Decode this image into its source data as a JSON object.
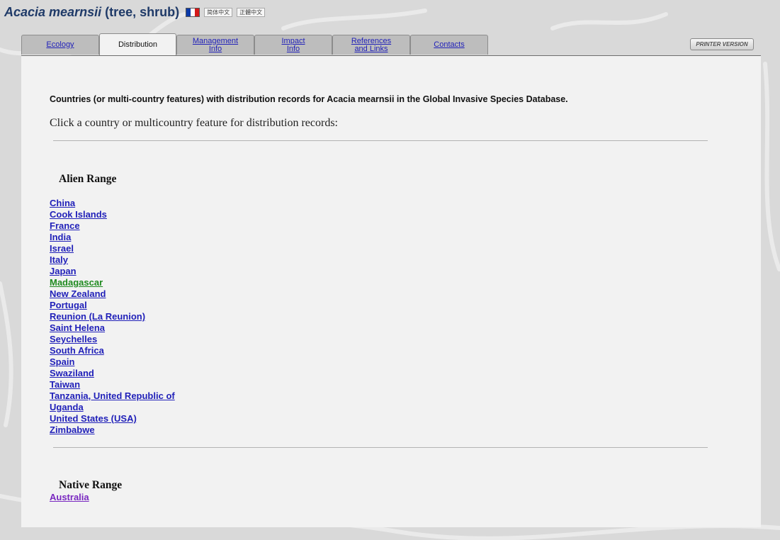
{
  "header": {
    "scientific_name": "Acacia mearnsii",
    "common_names": " (tree, shrub)",
    "lang_simplified": "简体中文",
    "lang_traditional": "正體中文",
    "flag_colors": [
      "#0b3aa8",
      "#ffffff",
      "#d41919"
    ]
  },
  "tabs": [
    {
      "label_line1": "Ecology",
      "label_line2": ""
    },
    {
      "label_line1": "Distribution",
      "label_line2": ""
    },
    {
      "label_line1": "Management",
      "label_line2": "Info"
    },
    {
      "label_line1": "Impact",
      "label_line2": "Info"
    },
    {
      "label_line1": "References",
      "label_line2": "and Links"
    },
    {
      "label_line1": "Contacts",
      "label_line2": ""
    }
  ],
  "printer_label": "PRINTER VERSION",
  "intro": "Countries (or multi-country features) with distribution records for Acacia mearnsii in the Global Invasive Species Database.",
  "click_prompt": "Click a country or multicountry feature for distribution records:",
  "alien_range": {
    "heading": "Alien Range",
    "countries": [
      {
        "name": "China",
        "color": "#2121b9"
      },
      {
        "name": "Cook Islands",
        "color": "#2121b9"
      },
      {
        "name": "France",
        "color": "#2121b9"
      },
      {
        "name": "India",
        "color": "#2121b9"
      },
      {
        "name": "Israel",
        "color": "#2121b9"
      },
      {
        "name": "Italy",
        "color": "#2121b9"
      },
      {
        "name": "Japan",
        "color": "#2121b9"
      },
      {
        "name": "Madagascar",
        "color": "#1f8a1f"
      },
      {
        "name": "New Zealand",
        "color": "#2121b9"
      },
      {
        "name": "Portugal",
        "color": "#2121b9"
      },
      {
        "name": "Reunion (La Reunion)",
        "color": "#2121b9"
      },
      {
        "name": "Saint Helena",
        "color": "#2121b9"
      },
      {
        "name": "Seychelles",
        "color": "#2121b9"
      },
      {
        "name": "South Africa",
        "color": "#2121b9"
      },
      {
        "name": "Spain",
        "color": "#2121b9"
      },
      {
        "name": "Swaziland",
        "color": "#2121b9"
      },
      {
        "name": "Taiwan",
        "color": "#2121b9"
      },
      {
        "name": "Tanzania, United Republic of",
        "color": "#2121b9"
      },
      {
        "name": "Uganda",
        "color": "#2121b9"
      },
      {
        "name": "United States (USA)",
        "color": "#2121b9"
      },
      {
        "name": "Zimbabwe",
        "color": "#2121b9"
      }
    ]
  },
  "native_range": {
    "heading": "Native Range",
    "countries": [
      {
        "name": "Australia",
        "color": "#7928c0"
      }
    ]
  }
}
